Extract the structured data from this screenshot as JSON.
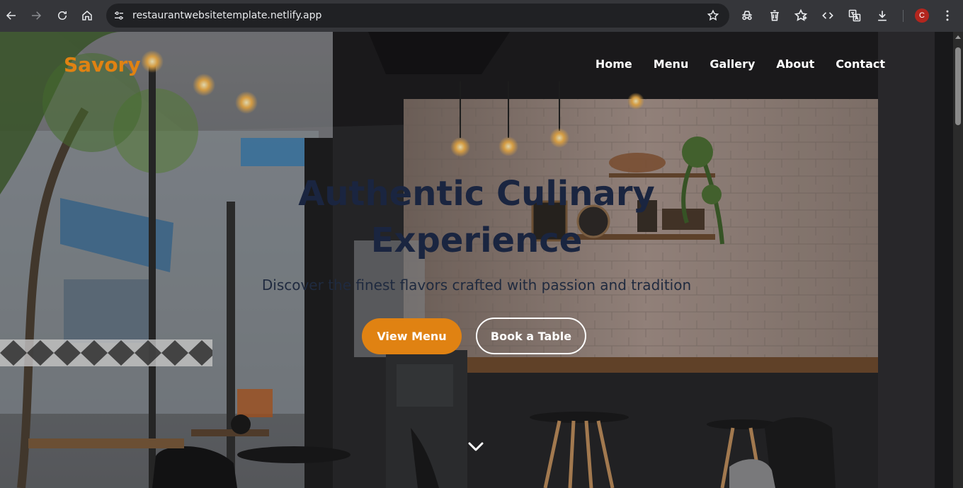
{
  "browser": {
    "url": "restaurantwebsitetemplate.netlify.app",
    "profile_initial": "C",
    "icons": [
      "back-icon",
      "forward-icon",
      "reload-icon",
      "home-icon",
      "site-info-icon",
      "bookmark-star-icon",
      "incognito-icon",
      "trash-icon",
      "favorites-icon",
      "code-icon",
      "translate-icon",
      "download-icon",
      "menu-dots-icon"
    ]
  },
  "site": {
    "brand": "Savory",
    "nav": [
      "Home",
      "Menu",
      "Gallery",
      "About",
      "Contact"
    ],
    "hero_title_line1": "Authentic Culinary",
    "hero_title_line2": "Experience",
    "hero_subtitle": "Discover the finest flavors crafted with passion and tradition",
    "primary_button": "View Menu",
    "secondary_button": "Book a Table",
    "scroll_icon": "chevron-down-icon"
  },
  "colors": {
    "accent": "#e08212",
    "hero_text": "#1a2540",
    "chrome": "#35363a"
  }
}
